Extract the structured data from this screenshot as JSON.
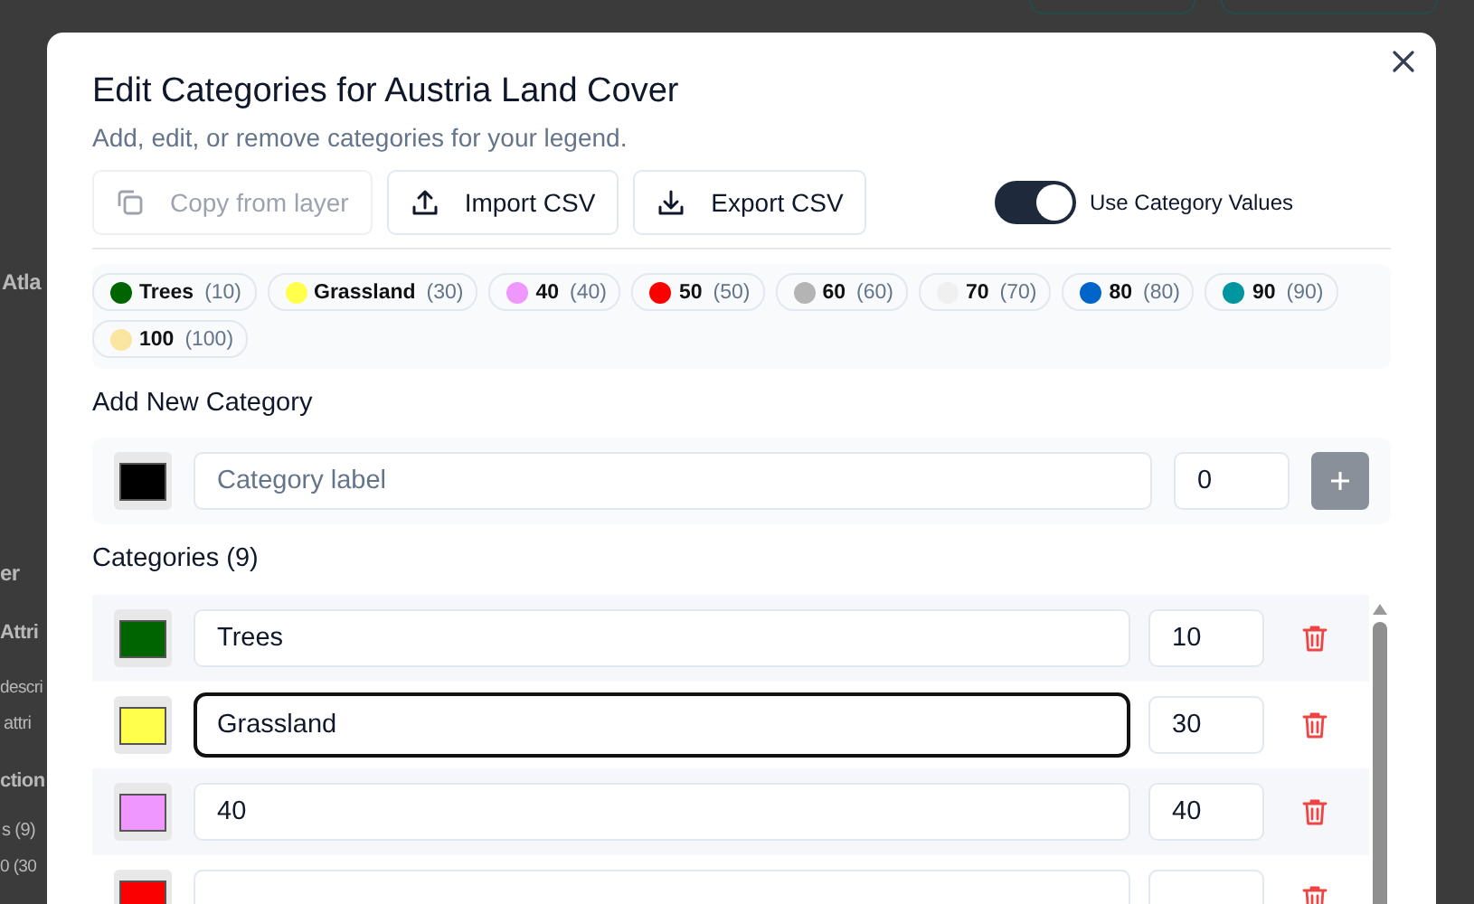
{
  "background_page": {
    "fragments": [
      "Atla",
      "er",
      "Attri",
      "descri",
      "attri",
      "ction",
      "s (9)",
      "0 (30"
    ]
  },
  "dialog": {
    "title": "Edit Categories for Austria Land Cover",
    "subtitle": "Add, edit, or remove categories for your legend.",
    "toolbar": [
      {
        "label": "Copy from layer",
        "kind": "copy",
        "disabled": true
      },
      {
        "label": "Import CSV",
        "kind": "import",
        "disabled": false
      },
      {
        "label": "Export CSV",
        "kind": "export",
        "disabled": false
      }
    ],
    "toggle": {
      "label": "Use Category Values",
      "on": true
    },
    "legend_chips": [
      {
        "label": "Trees",
        "value": "(10)",
        "color": "#006400"
      },
      {
        "label": "Grassland",
        "value": "(30)",
        "color": "#ffff4c"
      },
      {
        "label": "40",
        "value": "(40)",
        "color": "#f096ff"
      },
      {
        "label": "50",
        "value": "(50)",
        "color": "#fa0000"
      },
      {
        "label": "60",
        "value": "(60)",
        "color": "#b4b4b4"
      },
      {
        "label": "70",
        "value": "(70)",
        "color": "#f0f0f0"
      },
      {
        "label": "80",
        "value": "(80)",
        "color": "#0064c8"
      },
      {
        "label": "90",
        "value": "(90)",
        "color": "#0096a0"
      },
      {
        "label": "100",
        "value": "(100)",
        "color": "#fae6a0"
      }
    ],
    "add_section": {
      "heading": "Add New Category",
      "color": "#000000",
      "placeholder": "Category label",
      "value": "0"
    },
    "categories_heading": "Categories (9)",
    "categories": [
      {
        "label": "Trees",
        "value": "10",
        "color": "#006400",
        "focused": false
      },
      {
        "label": "Grassland",
        "value": "30",
        "color": "#ffff4c",
        "focused": true
      },
      {
        "label": "40",
        "value": "40",
        "color": "#f096ff",
        "focused": false
      },
      {
        "color": "#fa0000",
        "focused": false
      }
    ]
  }
}
